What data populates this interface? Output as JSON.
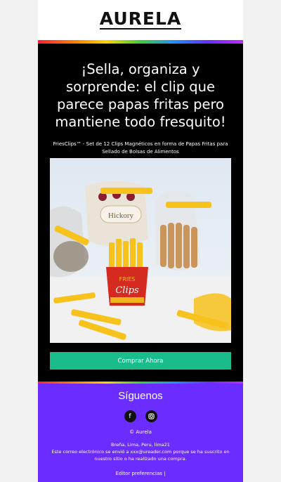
{
  "brand": {
    "logo_text": "AURELA"
  },
  "hero": {
    "headline": "¡Sella, organiza y sorprende: el clip que parece papas fritas pero mantiene todo fresquito!",
    "subtitle": "FriesClips™ - Set de 12 Clips Magnéticos en forma de Papas Fritas para Sellado de Bolsas de Alimentos"
  },
  "product": {
    "box_top_text": "FRIES",
    "box_main_text": "Clips",
    "bag_label": "Hickory"
  },
  "cta": {
    "label": "Comprar Ahora"
  },
  "footer": {
    "follow_label": "Síguenos",
    "social_icons": [
      "facebook-icon",
      "instagram-icon"
    ],
    "copyright": "© Aurela",
    "address": "Breña, Lima, Peru, lima21",
    "notice": "Este correo electrónico se envió a xxx@ureader.com porque se ha suscrito en nuestro sitio o ha realizado una compra.",
    "preferences": "Editor preferencias |"
  },
  "colors": {
    "cta": "#1abc8c",
    "footer": "#6b2cff",
    "background": "#000000"
  }
}
